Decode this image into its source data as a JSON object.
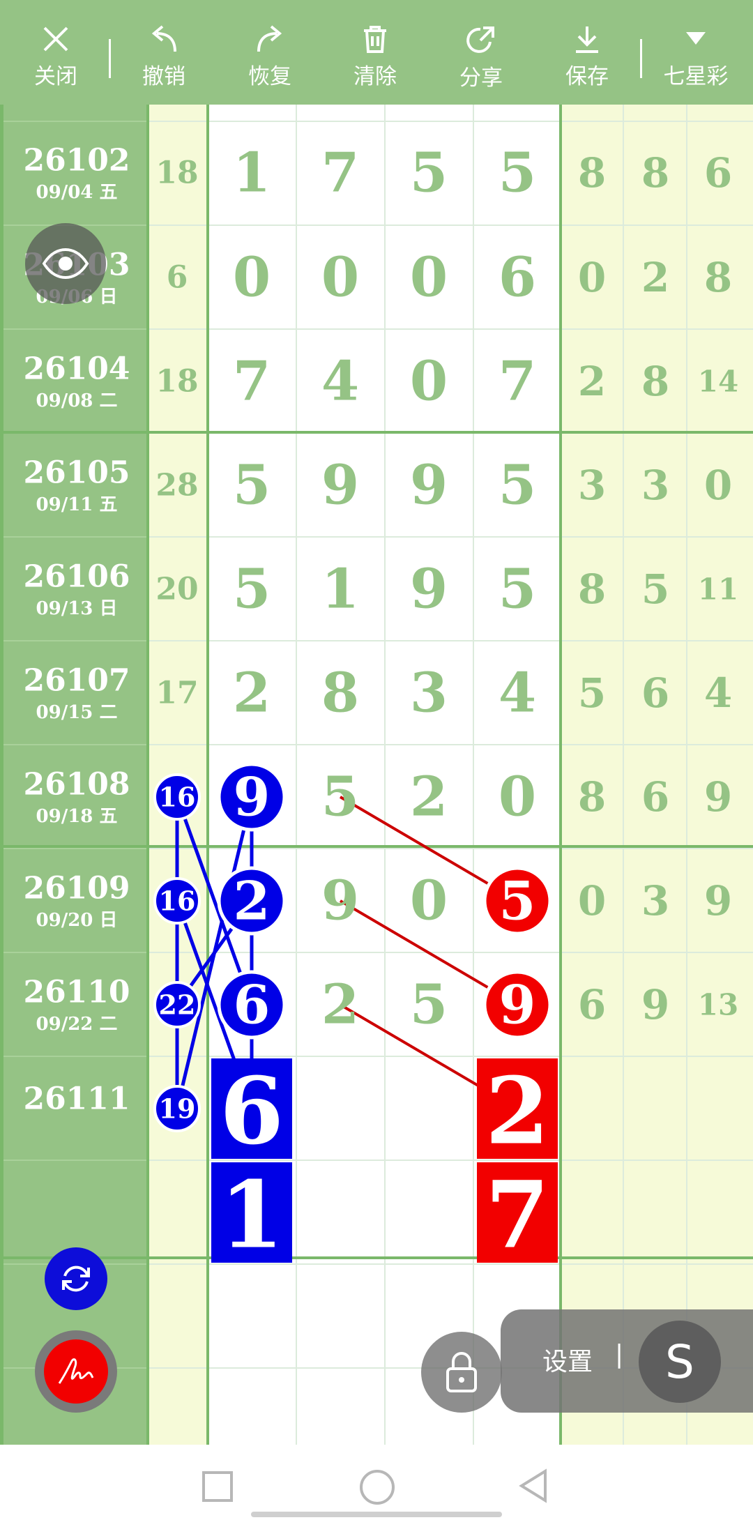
{
  "toolbar": {
    "close": "关闭",
    "undo": "撤销",
    "redo": "恢复",
    "clear": "清除",
    "share": "分享",
    "save": "保存",
    "lottery": "七星彩"
  },
  "rows": [
    {
      "period": "26102",
      "date": "09/04 五",
      "sum": "18",
      "main": [
        "1",
        "7",
        "5",
        "5"
      ],
      "tail": [
        "8",
        "8",
        "6"
      ]
    },
    {
      "period": "26103",
      "date": "09/06 日",
      "sum": "6",
      "main": [
        "0",
        "0",
        "0",
        "6"
      ],
      "tail": [
        "0",
        "2",
        "8"
      ]
    },
    {
      "period": "26104",
      "date": "09/08 二",
      "sum": "18",
      "main": [
        "7",
        "4",
        "0",
        "7"
      ],
      "tail": [
        "2",
        "8",
        "14"
      ]
    },
    {
      "period": "26105",
      "date": "09/11 五",
      "sum": "28",
      "main": [
        "5",
        "9",
        "9",
        "5"
      ],
      "tail": [
        "3",
        "3",
        "0"
      ]
    },
    {
      "period": "26106",
      "date": "09/13 日",
      "sum": "20",
      "main": [
        "5",
        "1",
        "9",
        "5"
      ],
      "tail": [
        "8",
        "5",
        "11"
      ]
    },
    {
      "period": "26107",
      "date": "09/15 二",
      "sum": "17",
      "main": [
        "2",
        "8",
        "3",
        "4"
      ],
      "tail": [
        "5",
        "6",
        "4"
      ]
    },
    {
      "period": "26108",
      "date": "09/18 五",
      "sum": "16",
      "main": [
        "9",
        "5",
        "2",
        "0"
      ],
      "tail": [
        "8",
        "6",
        "9"
      ]
    },
    {
      "period": "26109",
      "date": "09/20 日",
      "sum": "16",
      "main": [
        "2",
        "9",
        "0",
        "5"
      ],
      "tail": [
        "0",
        "3",
        "9"
      ]
    },
    {
      "period": "26110",
      "date": "09/22 二",
      "sum": "22",
      "main": [
        "6",
        "2",
        "5",
        "9"
      ],
      "tail": [
        "6",
        "9",
        "13"
      ]
    },
    {
      "period": "26111",
      "date": "",
      "sum": "19",
      "main": [
        "6",
        "",
        "",
        "2"
      ],
      "tail": [
        "",
        "",
        ""
      ]
    },
    {
      "period": "",
      "date": "",
      "sum": "",
      "main": [
        "1",
        "",
        "",
        "7"
      ],
      "tail": [
        "",
        "",
        ""
      ]
    }
  ],
  "highlights": {
    "blue_circles": [
      [
        6,
        0
      ],
      [
        6,
        1
      ],
      [
        7,
        0
      ],
      [
        7,
        1
      ],
      [
        8,
        0
      ],
      [
        8,
        1
      ],
      [
        9,
        0
      ]
    ],
    "red_circles": [
      [
        6,
        2
      ],
      [
        7,
        2
      ],
      [
        7,
        5
      ],
      [
        8,
        2
      ],
      [
        8,
        5
      ]
    ],
    "blue_squares": [
      [
        9,
        1
      ],
      [
        10,
        1
      ]
    ],
    "red_squares": [
      [
        9,
        5
      ],
      [
        10,
        5
      ]
    ]
  },
  "panel": {
    "settings": "设置",
    "separator": "|",
    "s_letter": "S"
  },
  "colors": {
    "sidebar": "#95c385",
    "digit": "#95c385",
    "blue": "#0000e6",
    "red": "#f20000",
    "yellow": "#f6fad8",
    "gridline": "#dcebdc"
  }
}
